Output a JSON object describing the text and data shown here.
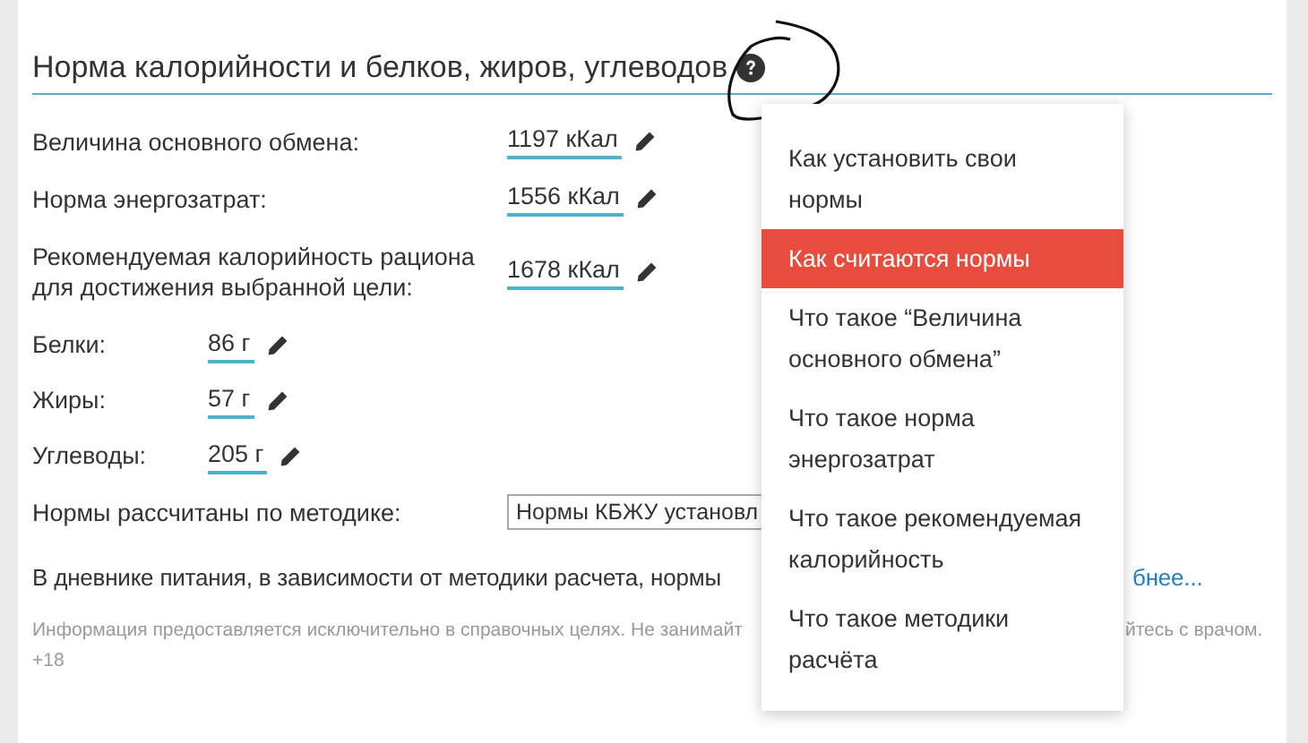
{
  "title": "Норма калорийности и белков, жиров, углеводов",
  "norms": [
    {
      "label": "Величина основного обмена:",
      "value": "1197 кКал"
    },
    {
      "label": "Норма энергозатрат:",
      "value": "1556 кКал"
    },
    {
      "label": "Рекомендуемая калорийность рациона для достижения выбранной цели:",
      "value": "1678 кКал"
    }
  ],
  "macros": [
    {
      "label": "Белки:",
      "value": "86 г"
    },
    {
      "label": "Жиры:",
      "value": "57 г"
    },
    {
      "label": "Углеводы:",
      "value": "205 г"
    }
  ],
  "method": {
    "label": "Нормы рассчитаны по методике:",
    "value": "Нормы КБЖУ установл"
  },
  "note": {
    "text": "В дневнике питания, в зависимости от методики расчета, нормы",
    "link": "бнее..."
  },
  "disclaimer": {
    "text": "Информация предоставляется исключительно в справочных целях. Не занимайт",
    "text_end": "йтесь с врачом.",
    "age": "+18"
  },
  "help_menu": {
    "items": [
      {
        "label": "Как установить свои нормы",
        "selected": false
      },
      {
        "label": "Как считаются нормы",
        "selected": true
      },
      {
        "label": "Что такое “Величина основного обмена”",
        "selected": false
      },
      {
        "label": "Что такое норма энергозатрат",
        "selected": false
      },
      {
        "label": "Что такое рекомендуемая калорийность",
        "selected": false
      },
      {
        "label": "Что такое методики расчёта",
        "selected": false
      }
    ]
  }
}
